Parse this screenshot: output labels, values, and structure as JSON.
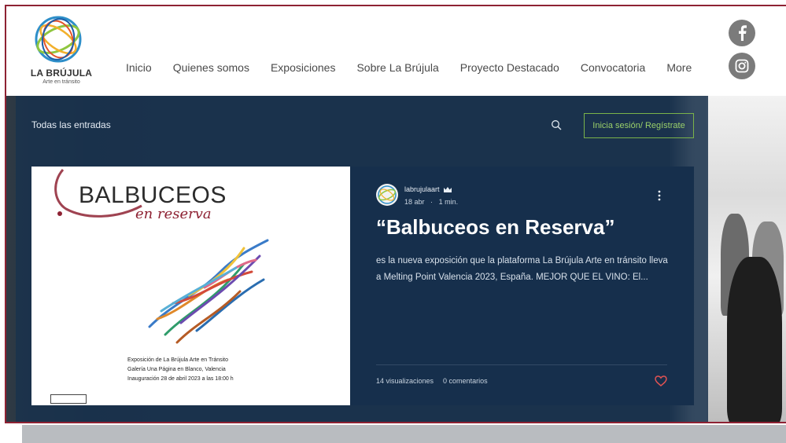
{
  "logo": {
    "title": "LA BRÚJULA",
    "subtitle": "Arte en tránsito"
  },
  "nav": {
    "items": [
      "Inicio",
      "Quienes somos",
      "Exposiciones",
      "Sobre La Brújula",
      "Proyecto Destacado",
      "Convocatoria",
      "More"
    ]
  },
  "social": {
    "facebook_icon": "facebook-icon",
    "instagram_icon": "instagram-icon"
  },
  "blog": {
    "all_posts_label": "Todas las entradas",
    "search_icon": "search-icon",
    "login_label": "Inicia sesión/ Regístrate"
  },
  "post": {
    "author": "labrujulaart",
    "date": "18 abr",
    "separator": "·",
    "read_time": "1 min.",
    "title": "“Balbuceos en Reserva”",
    "excerpt": "es la nueva exposición que la plataforma La Brújula Arte en tránsito lleva a Melting Point Valencia 2023, España. MEJOR QUE EL VINO: El...",
    "views": "14 visualizaciones",
    "comments": "0 comentarios"
  },
  "poster": {
    "title": "BALBUCEOS",
    "subtitle": "en reserva",
    "lines": [
      "Exposición de La Brújula Arte en Tránsito",
      "Galería Una Página en Blanco, Valencia",
      "Inauguración 28 de abril 2023 a las 18:00 h"
    ]
  },
  "colors": {
    "border": "#8e2233",
    "panel": "#1a324d",
    "accent_green": "#7ab34a",
    "heart": "#e05353"
  }
}
